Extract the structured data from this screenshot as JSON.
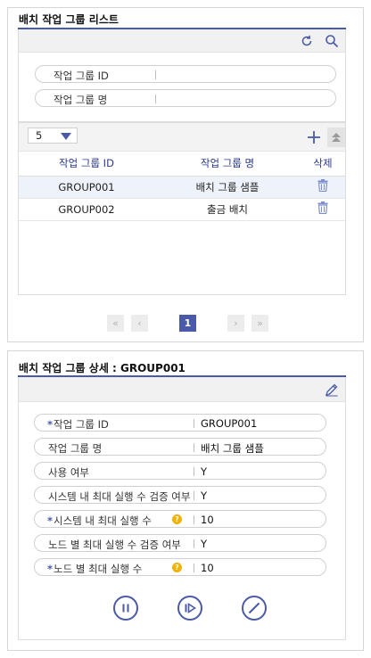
{
  "list_panel": {
    "title": "배치 작업 그룹 리스트",
    "search": {
      "group_id_label": "작업 그룹 ID",
      "group_id_value": "",
      "group_name_label": "작업 그룹 명",
      "group_name_value": ""
    },
    "page_size": "5",
    "columns": [
      "작업 그룹 ID",
      "작업 그룹 명",
      "삭제"
    ],
    "rows": [
      {
        "id": "GROUP001",
        "name": "배치 그룹 샘플"
      },
      {
        "id": "GROUP002",
        "name": "출금 배치"
      }
    ],
    "pagination": {
      "first": "«",
      "prev": "‹",
      "current": "1",
      "next": "›",
      "last": "»"
    }
  },
  "detail_panel": {
    "title": "배치 작업 그룹 상세 : GROUP001",
    "fields": [
      {
        "label": "작업 그룹 ID",
        "required": "*",
        "value": "GROUP001"
      },
      {
        "label": "작업 그룹 명",
        "required": "",
        "value": "배치 그룹 샘플"
      },
      {
        "label": "사용 여부",
        "required": "",
        "value": "Y"
      },
      {
        "label": "시스템 내 최대 실행 수 검증 여부",
        "required": "",
        "value": "Y"
      },
      {
        "label": "시스템 내 최대 실행 수",
        "required": "*",
        "value": "10",
        "help": "?"
      },
      {
        "label": "노드 별 최대 실행 수 검증 여부",
        "required": "",
        "value": "Y"
      },
      {
        "label": "노드 별 최대 실행 수",
        "required": "*",
        "value": "10",
        "help": "?"
      }
    ]
  },
  "icons": {
    "refresh": "refresh-icon",
    "search": "search-icon",
    "add": "plus-icon",
    "collapse": "collapse-up-icon",
    "delete": "trash-icon",
    "edit": "pencil-icon",
    "pause": "pause-icon",
    "resume": "resume-icon",
    "disable": "disable-icon"
  },
  "colors": {
    "accent": "#4a5aa8",
    "header_text": "#2b3a8c",
    "selected_row": "#eef3fb",
    "help_badge": "#f2b100"
  }
}
